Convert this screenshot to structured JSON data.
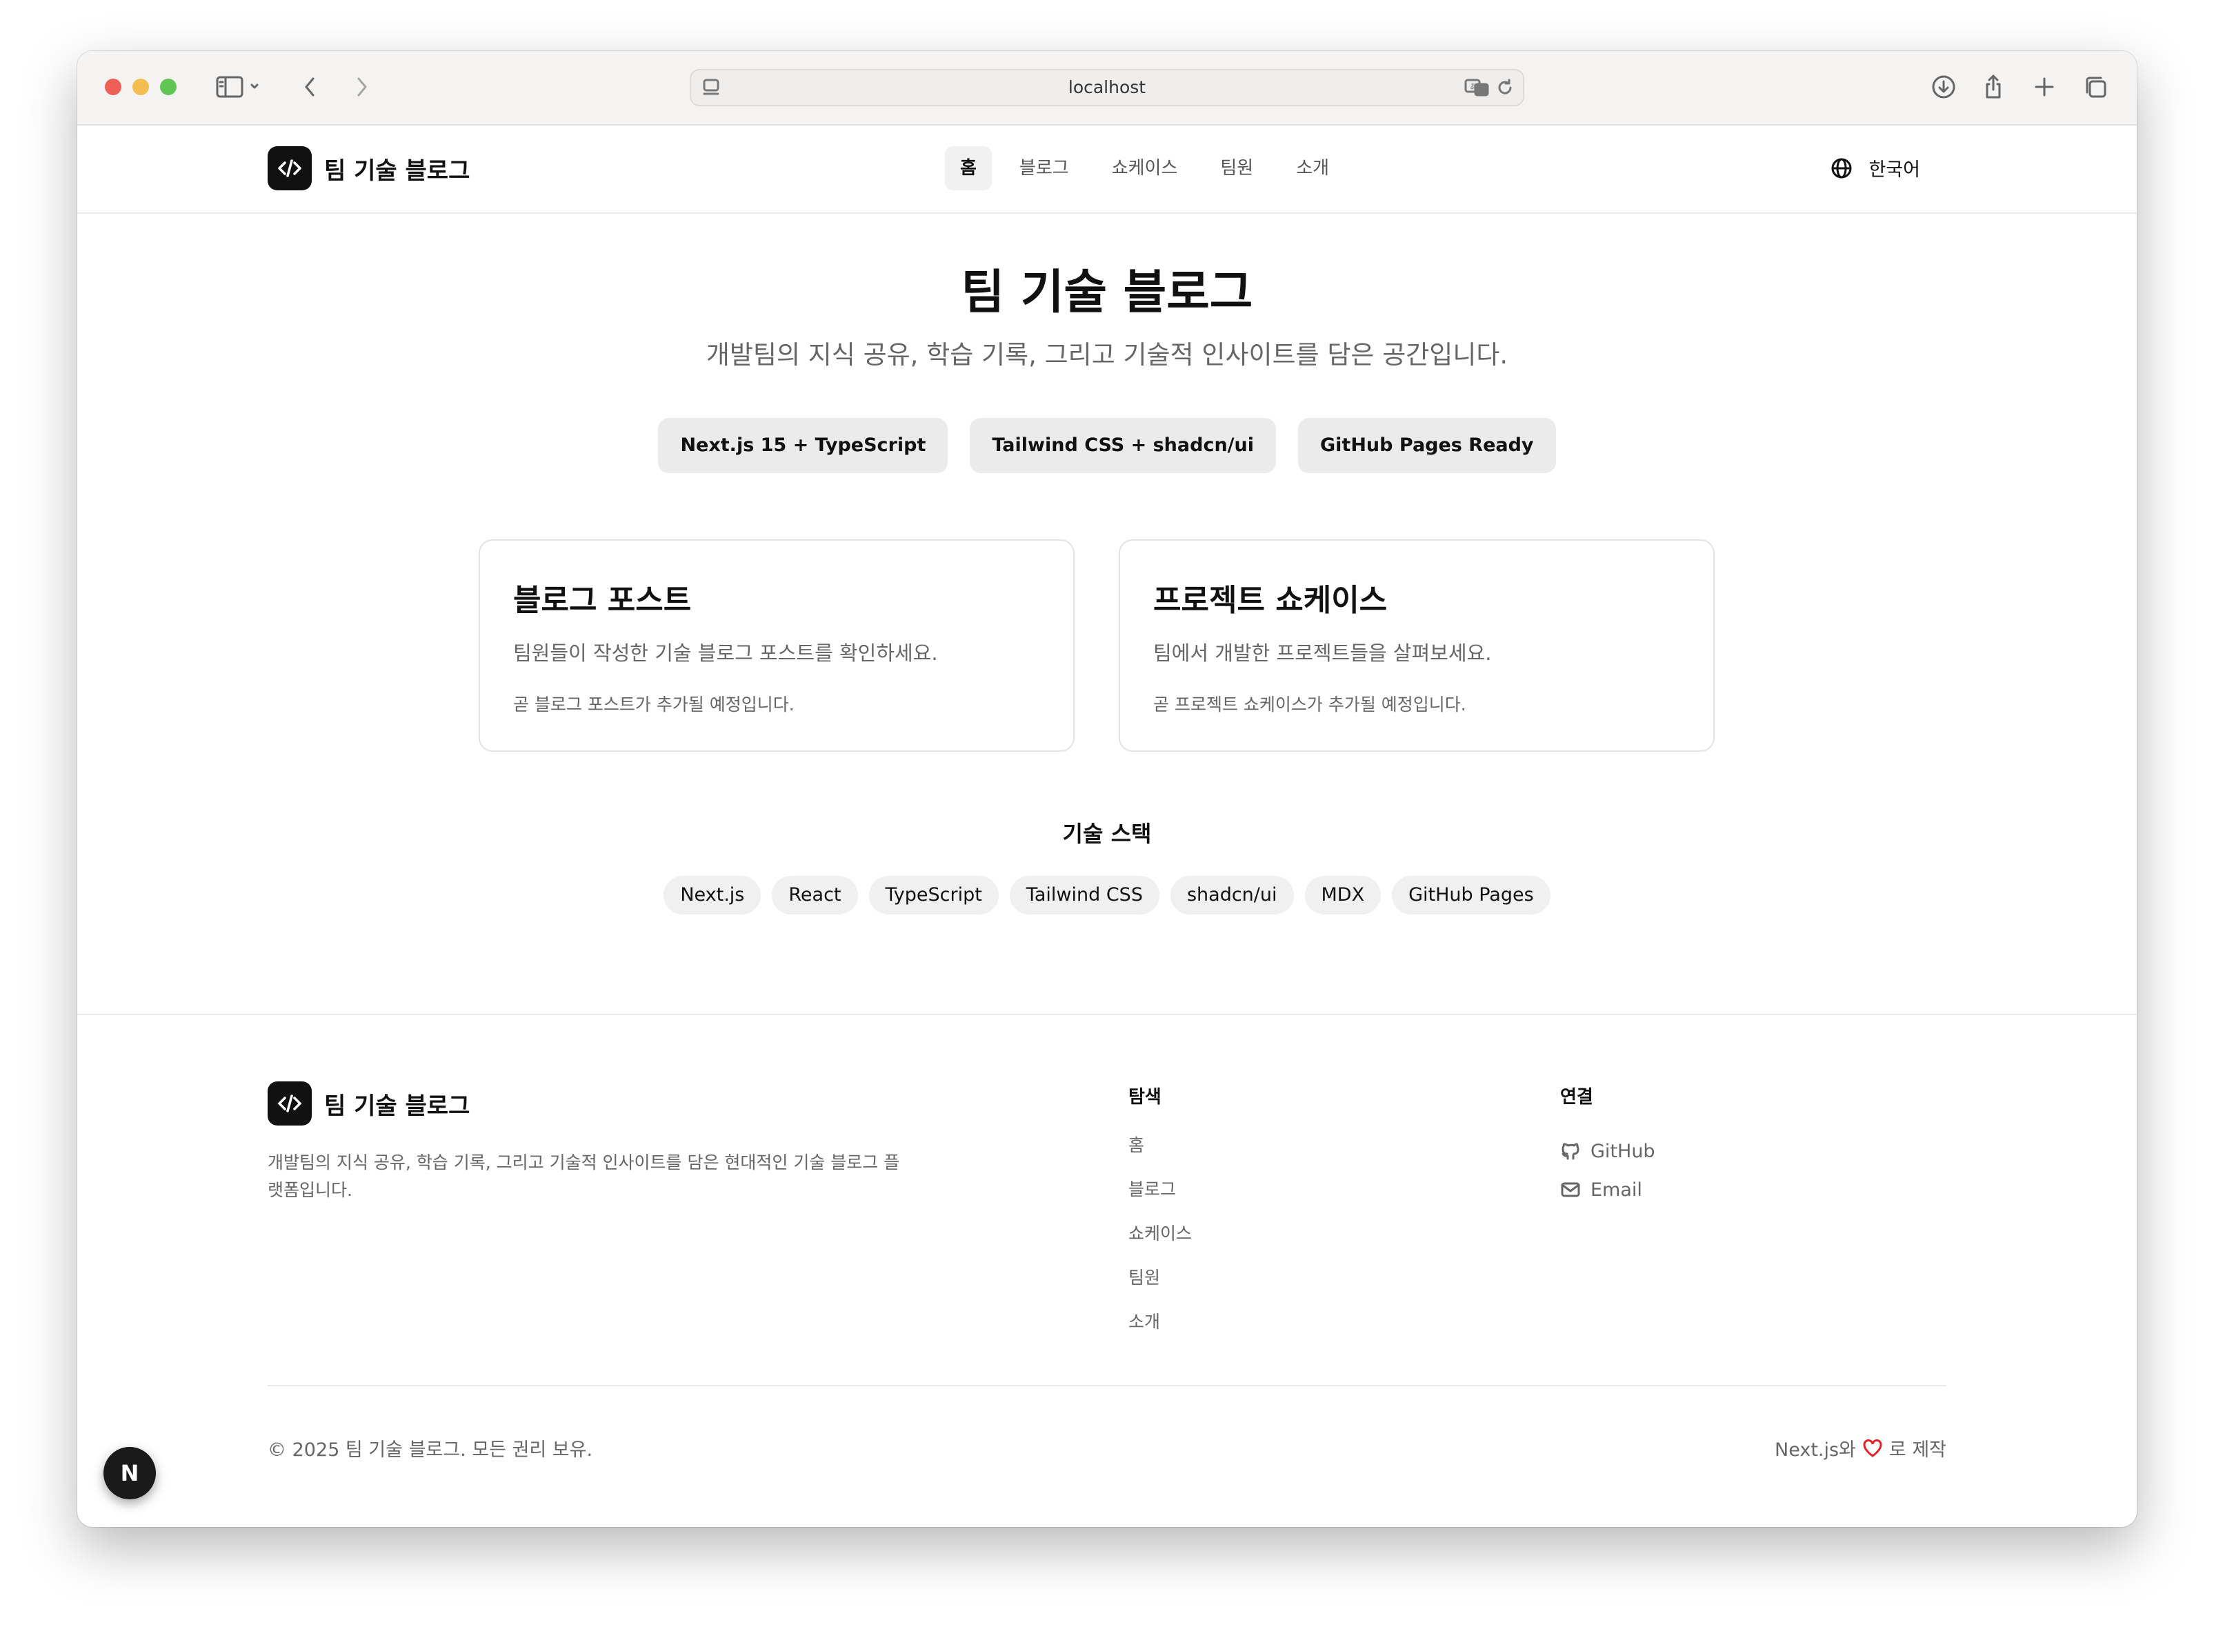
{
  "browser": {
    "url": "localhost"
  },
  "header": {
    "logo_text": "팀 기술 블로그",
    "nav": [
      {
        "label": "홈",
        "active": true
      },
      {
        "label": "블로그",
        "active": false
      },
      {
        "label": "쇼케이스",
        "active": false
      },
      {
        "label": "팀원",
        "active": false
      },
      {
        "label": "소개",
        "active": false
      }
    ],
    "language": "한국어"
  },
  "hero": {
    "title": "팀 기술 블로그",
    "subtitle": "개발팀의 지식 공유, 학습 기록, 그리고 기술적 인사이트를 담은 공간입니다.",
    "chips": [
      "Next.js 15 + TypeScript",
      "Tailwind CSS + shadcn/ui",
      "GitHub Pages Ready"
    ]
  },
  "cards": [
    {
      "title": "블로그 포스트",
      "description": "팀원들이 작성한 기술 블로그 포스트를 확인하세요.",
      "status": "곧 블로그 포스트가 추가될 예정입니다."
    },
    {
      "title": "프로젝트 쇼케이스",
      "description": "팀에서 개발한 프로젝트들을 살펴보세요.",
      "status": "곧 프로젝트 쇼케이스가 추가될 예정입니다."
    }
  ],
  "tech_stack": {
    "title": "기술 스택",
    "items": [
      "Next.js",
      "React",
      "TypeScript",
      "Tailwind CSS",
      "shadcn/ui",
      "MDX",
      "GitHub Pages"
    ]
  },
  "footer": {
    "logo_text": "팀 기술 블로그",
    "description": "개발팀의 지식 공유, 학습 기록, 그리고 기술적 인사이트를 담은 현대적인 기술 블로그 플랫폼입니다.",
    "explore": {
      "title": "탐색",
      "links": [
        "홈",
        "블로그",
        "쇼케이스",
        "팀원",
        "소개"
      ]
    },
    "connect": {
      "title": "연결",
      "links": [
        {
          "label": "GitHub",
          "icon": "github-icon"
        },
        {
          "label": "Email",
          "icon": "mail-icon"
        }
      ]
    },
    "copyright": "© 2025 팀 기술 블로그. 모든 권리 보유.",
    "made_with_prefix": "Next.js와",
    "made_with_suffix": "로 제작"
  },
  "dev_badge": "N",
  "colors": {
    "accent": "#111111",
    "chip_bg": "#ebebeb",
    "heart": "#e02424"
  }
}
